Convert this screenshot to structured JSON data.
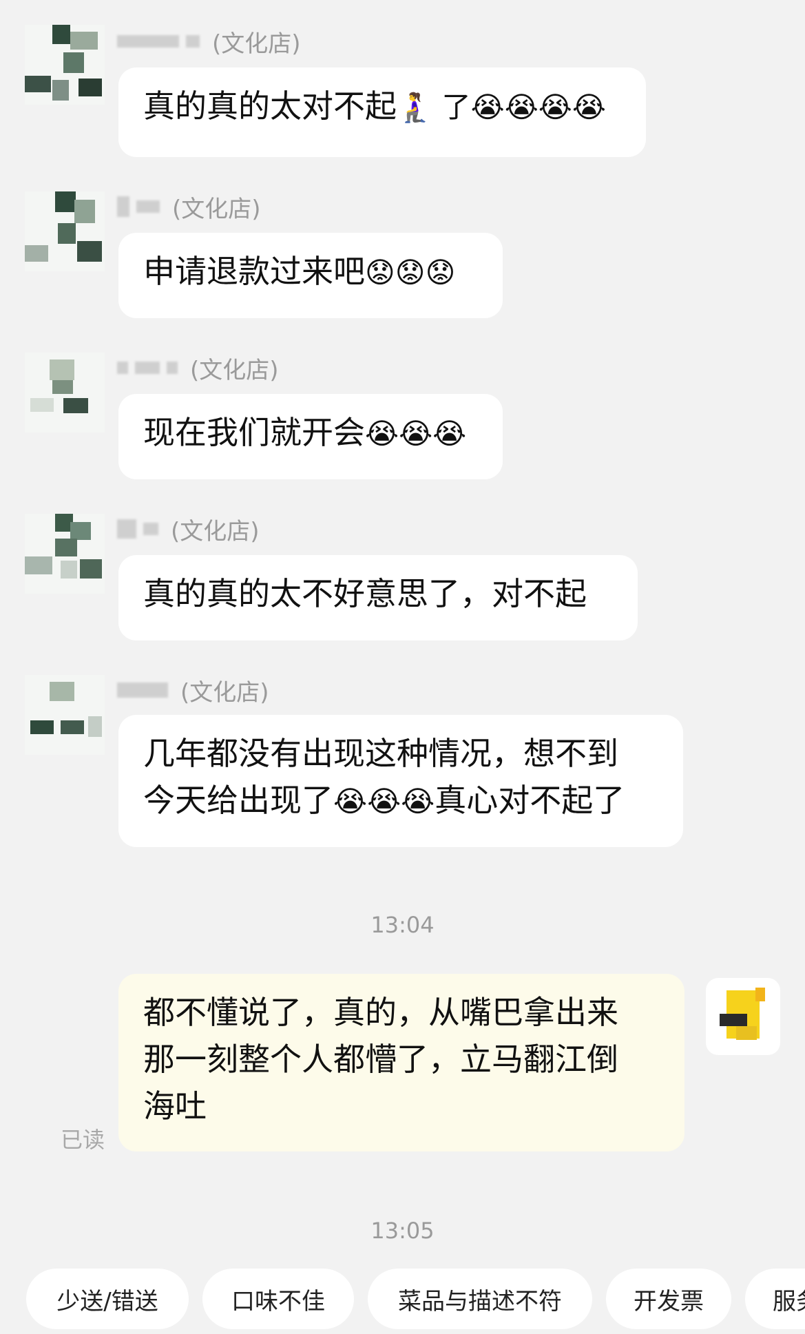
{
  "chat": {
    "messages": [
      {
        "shop": "(文化店)",
        "text": "真的真的太对不起",
        "emoji_tail": "🧎‍♀️ 了😭😭😭😭"
      },
      {
        "shop": "(文化店)",
        "text": "申请退款过来吧",
        "emoji_tail": "😟😟😟"
      },
      {
        "shop": "(文化店)",
        "text": "现在我们就开会",
        "emoji_tail": "😭😭😭"
      },
      {
        "shop": "(文化店)",
        "text": "真的真的太不好意思了，对不起",
        "emoji_tail": ""
      },
      {
        "shop": "(文化店)",
        "line1": "几年都没有出现这种情况，想不到",
        "line2_start": "今天给出现了",
        "line2_emoji": "😭😭😭",
        "line2_end": "真心对不起了"
      }
    ],
    "time1": "13:04",
    "my_message": {
      "line1": "都不懂说了，真的，从嘴巴拿出来",
      "line2": "那一刻整个人都懵了，立马翻江倒",
      "line3": "海吐"
    },
    "read_status": "已读",
    "time2": "13:05"
  },
  "quick_replies": [
    "少送/错送",
    "口味不佳",
    "菜品与描述不符",
    "开发票",
    "服务"
  ]
}
